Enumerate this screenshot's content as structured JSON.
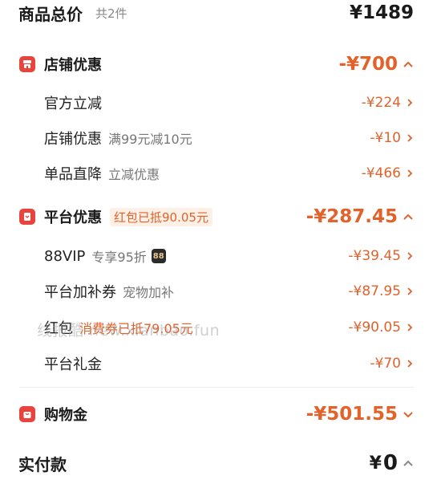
{
  "total": {
    "title": "商品总价",
    "count": "共2件",
    "amount": "¥1489"
  },
  "shop": {
    "icon": "shop-icon",
    "title": "店铺优惠",
    "amount": "-¥700",
    "items": [
      {
        "label": "官方立减",
        "note": "",
        "amount": "-¥224"
      },
      {
        "label": "店铺优惠",
        "note": "满99元减10元",
        "amount": "-¥10"
      },
      {
        "label": "单品直降",
        "note": "立减优惠",
        "amount": "-¥466"
      }
    ]
  },
  "platform": {
    "icon": "platform-coupon-icon",
    "title": "平台优惠",
    "badge": "红包已抵90.05元",
    "amount": "-¥287.45",
    "items": [
      {
        "label": "88VIP",
        "note": "专享95折",
        "vip_badge": "88",
        "amount": "-¥39.45"
      },
      {
        "label": "平台加补券",
        "note": "宠物加补",
        "amount": "-¥87.95"
      },
      {
        "label": "红包",
        "note": "消费券已抵79.05元",
        "amount": "-¥90.05"
      },
      {
        "label": "平台礼金",
        "note": "",
        "amount": "-¥70"
      }
    ]
  },
  "shopping_gold": {
    "icon": "shopping-bag-icon",
    "title": "购物金",
    "amount": "-¥501.55"
  },
  "payment": {
    "title": "实付款",
    "currency": "¥",
    "amount": "0"
  },
  "watermark": "线报酷 new.xianbao.fun",
  "colors": {
    "accent": "#e2622b",
    "icon_red": "#e8433d"
  }
}
